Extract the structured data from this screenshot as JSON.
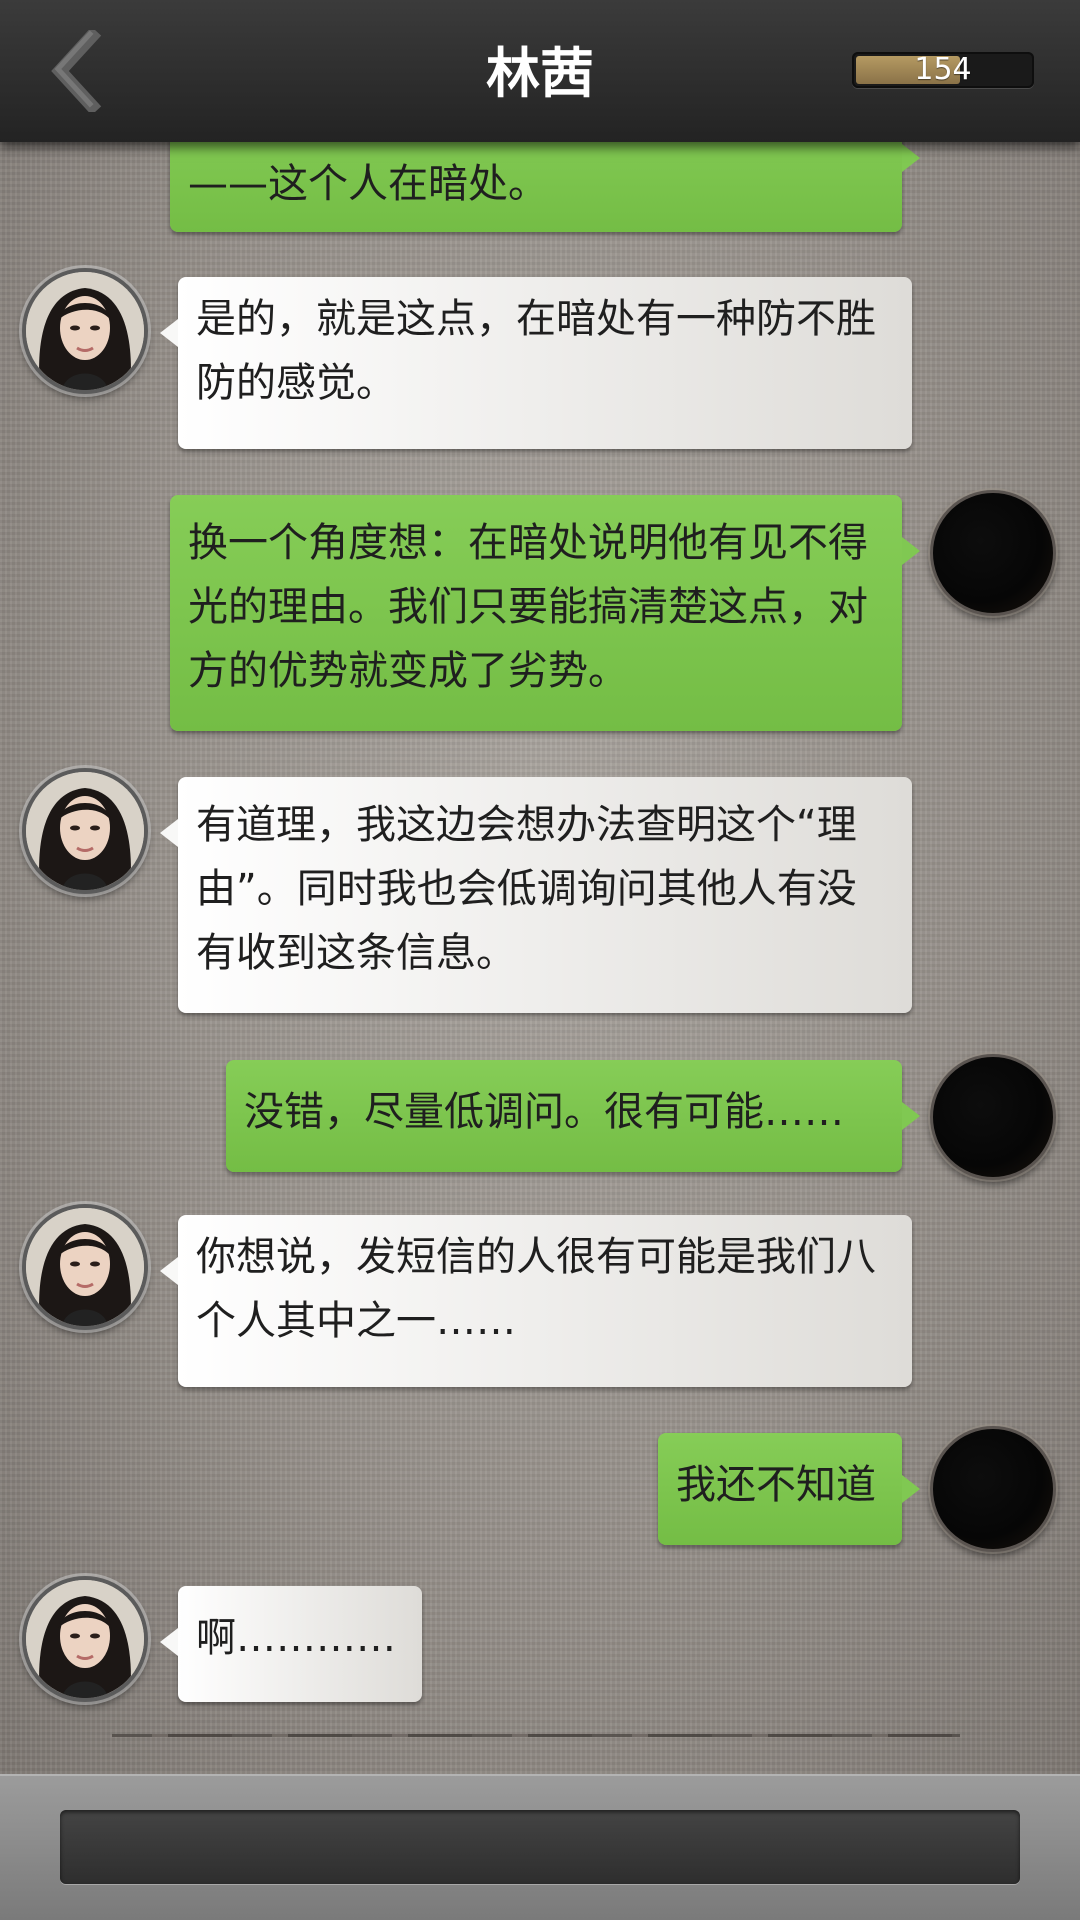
{
  "header": {
    "title": "林茜",
    "counter_value": "154",
    "counter_fill_fraction": 0.6
  },
  "messages": [
    {
      "side": "out",
      "text": "——这个人在暗处。"
    },
    {
      "side": "in",
      "text": "是的，就是这点，在暗处有一种防不胜防的感觉。"
    },
    {
      "side": "out",
      "text": "换一个角度想：在暗处说明他有见不得光的理由。我们只要能搞清楚这点，对方的优势就变成了劣势。"
    },
    {
      "side": "in",
      "text": "有道理，我这边会想办法查明这个“理由”。同时我也会低调询问其他人有没有收到这条信息。"
    },
    {
      "side": "out",
      "text": "没错，尽量低调问。很有可能……"
    },
    {
      "side": "in",
      "text": "你想说，发短信的人很有可能是我们八个人其中之一……"
    },
    {
      "side": "out",
      "text": "我还不知道"
    },
    {
      "side": "in",
      "text": "啊…………"
    }
  ],
  "colors": {
    "header": "#2b2b2b",
    "outgoing_bubble": "#7ec64e",
    "incoming_bubble": "#f2f1ef",
    "counter_fill": "#a48a57"
  },
  "icons": {
    "back": "chevron-left-icon",
    "her_avatar": "woman-portrait-avatar",
    "my_avatar": "dark-circle-avatar"
  }
}
